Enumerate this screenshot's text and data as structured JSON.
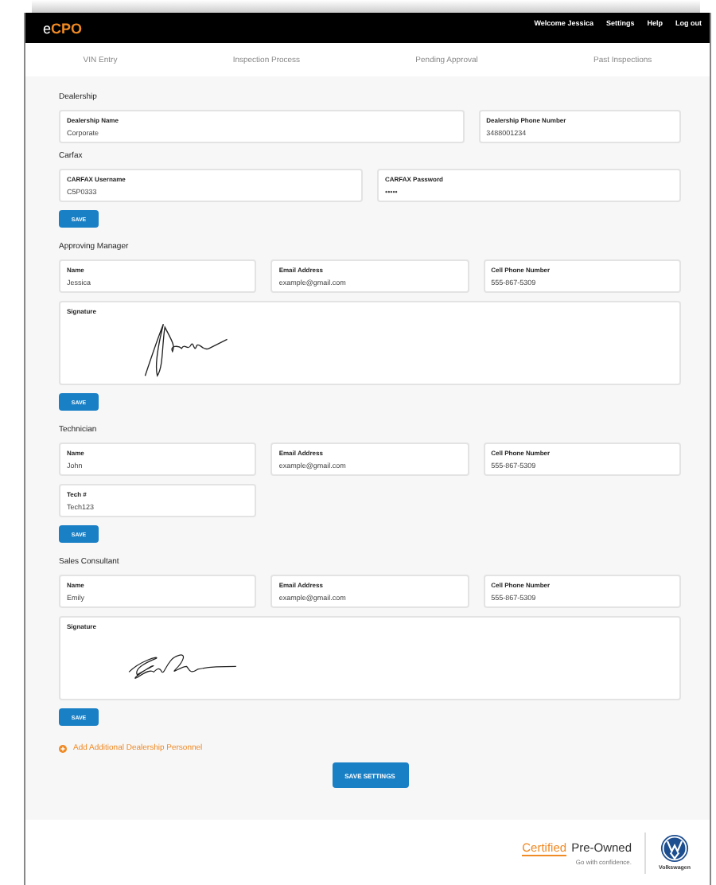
{
  "header": {
    "logo": {
      "prefix": "e",
      "main": "CPO"
    },
    "links": [
      "Welcome Jessica",
      "Settings",
      "Help",
      "Log out"
    ]
  },
  "tabs": [
    {
      "label": "VIN Entry",
      "selected": false
    },
    {
      "label": "Inspection Process",
      "selected": false
    },
    {
      "label": "Pending Approval",
      "selected": false
    },
    {
      "label": "Past Inspections",
      "selected": false
    }
  ],
  "sections": [
    {
      "kind": "dealership",
      "title": "Dealership",
      "rows": [
        [
          {
            "label": "Dealership Name",
            "value": "Corporate"
          },
          {
            "label": "Dealership Phone Number",
            "value": "3488001234"
          }
        ]
      ]
    },
    {
      "kind": "credentials",
      "title": "Carfax",
      "rows": [
        [
          {
            "label": "CARFAX Username",
            "value": "C5P0333"
          },
          {
            "label": "CARFAX Password",
            "value": "•••••"
          }
        ]
      ],
      "save": "SAVE"
    },
    {
      "kind": "personnel",
      "title": "Approving Manager",
      "rows": [
        [
          {
            "label": "Name",
            "value": "Jessica"
          },
          {
            "label": "Email Address",
            "value": "example@gmail.com"
          },
          {
            "label": "Cell Phone Number",
            "value": "555-867-5309"
          }
        ]
      ],
      "signature": {
        "label": "Signature"
      },
      "save": "SAVE"
    },
    {
      "kind": "personnel",
      "title": "Technician",
      "rows": [
        [
          {
            "label": "Name",
            "value": "John"
          },
          {
            "label": "Email Address",
            "value": "example@gmail.com"
          },
          {
            "label": "Cell Phone Number",
            "value": "555-867-5309"
          }
        ],
        [
          {
            "label": "Tech #",
            "value": "Tech123"
          }
        ]
      ],
      "save": "SAVE"
    },
    {
      "kind": "personnel",
      "title": "Sales Consultant",
      "rows": [
        [
          {
            "label": "Name",
            "value": "Emily"
          },
          {
            "label": "Email Address",
            "value": "example@gmail.com"
          },
          {
            "label": "Cell Phone Number",
            "value": "555-867-5309"
          }
        ]
      ],
      "signature": {
        "label": "Signature"
      },
      "save": "SAVE"
    }
  ],
  "add_link": "Add Additional Dealership Personnel",
  "save_settings": "SAVE SETTINGS",
  "footer": {
    "certified": "Certified",
    "pre_owned": "Pre-Owned",
    "tagline": "Go with confidence.",
    "brand": "Volkswagen"
  }
}
